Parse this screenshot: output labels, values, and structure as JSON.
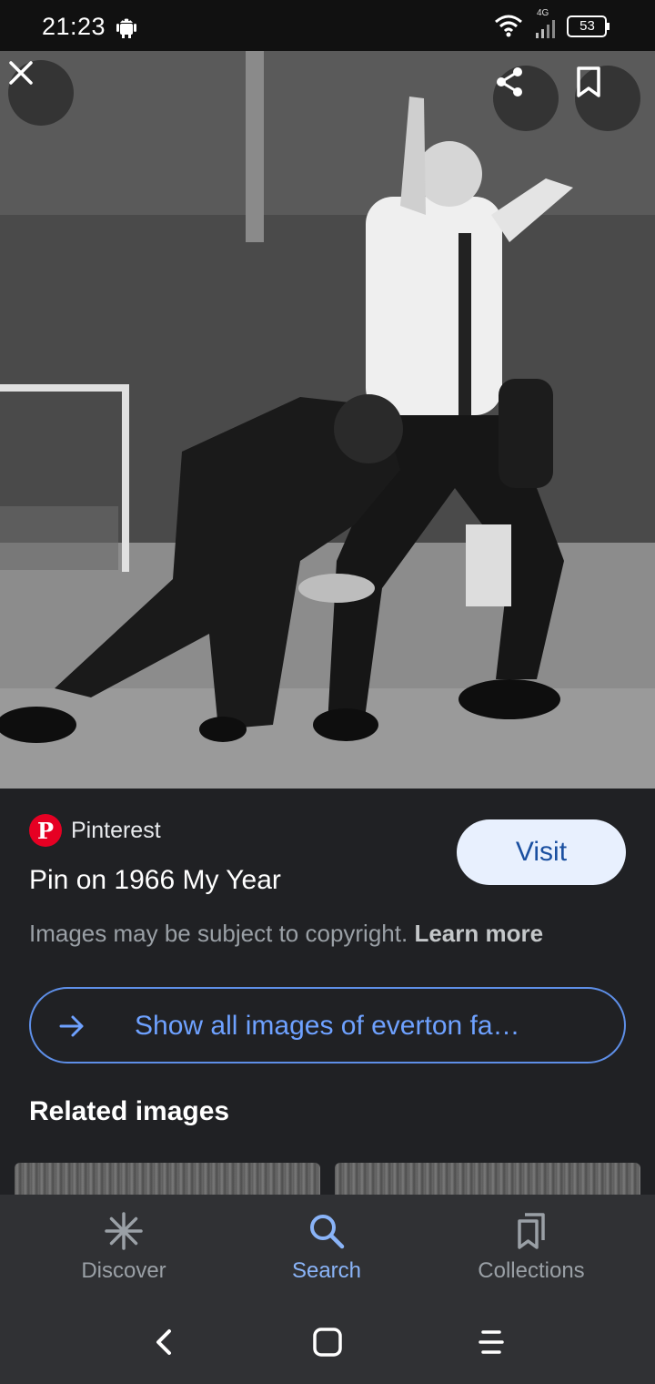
{
  "status_bar": {
    "time": "21:23",
    "network_label": "4G",
    "battery_level": "53"
  },
  "image_viewer": {
    "close_icon": "close-icon",
    "share_icon": "share-icon",
    "bookmark_icon": "bookmark-icon"
  },
  "result": {
    "source_icon": "pinterest-icon",
    "source_icon_letter": "P",
    "source_name": "Pinterest",
    "title": "Pin on 1966 My Year",
    "visit_label": "Visit",
    "copyright_text": "Images may be subject to copyright.",
    "learn_more_label": "Learn more",
    "show_all_label": "Show all images of everton fa…",
    "related_heading": "Related images"
  },
  "bottom_nav": {
    "items": [
      {
        "label": "Discover",
        "icon": "asterisk-icon",
        "active": false
      },
      {
        "label": "Search",
        "icon": "search-icon",
        "active": true
      },
      {
        "label": "Collections",
        "icon": "collections-icon",
        "active": false
      }
    ]
  },
  "colors": {
    "background": "#202124",
    "accent": "#8ab4f8",
    "visit_button_bg": "#e8f0fe",
    "pinterest_red": "#e60023"
  }
}
